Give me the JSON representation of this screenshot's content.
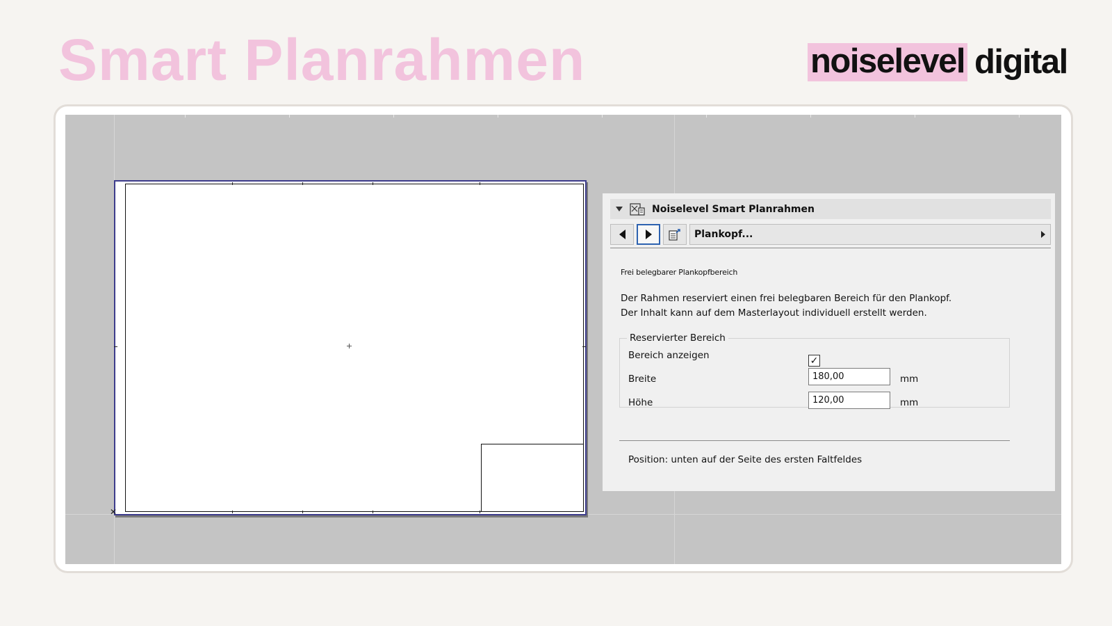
{
  "slide": {
    "title": "Smart Planrahmen",
    "logo_highlight": "noiselevel",
    "logo_rest": "digital",
    "accent_color": "#f2c3dd"
  },
  "panel": {
    "header_title": "Noiselevel Smart Planrahmen",
    "header_icon": "object-settings-icon",
    "toolbar": {
      "prev_icon": "triangle-left-icon",
      "next_icon": "triangle-right-icon",
      "page_icon": "page-export-icon",
      "dropdown_label": "Plankopf..."
    },
    "small_label": "Frei belegbarer Plankopfbereich",
    "description_line1": "Der Rahmen reserviert einen frei belegbaren Bereich für den Plankopf.",
    "description_line2": "Der Inhalt kann auf dem Masterlayout individuell erstellt werden.",
    "group": {
      "legend": "Reservierter Bereich",
      "show_area_label": "Bereich anzeigen",
      "show_area_checked": true,
      "width_label": "Breite",
      "width_value": "180,00",
      "width_unit": "mm",
      "height_label": "Höhe",
      "height_value": "120,00",
      "height_unit": "mm"
    },
    "position_text": "Position: unten auf der Seite des ersten Faltfeldes"
  }
}
